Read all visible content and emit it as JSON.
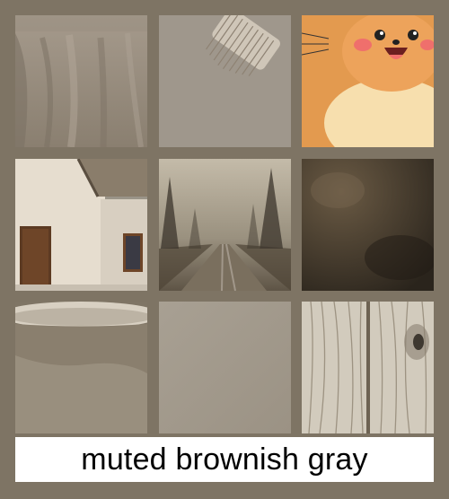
{
  "caption": {
    "text": "muted brownish gray"
  },
  "colors": {
    "background": "#7e7464",
    "caption_background": "#ffffff",
    "caption_text": "#000000"
  },
  "tiles": [
    {
      "subject": "draped-fabric"
    },
    {
      "subject": "paintbrush-on-gray-surface"
    },
    {
      "subject": "cartoon-cat"
    },
    {
      "subject": "cottage-with-thatched-roof"
    },
    {
      "subject": "foggy-forest-road"
    },
    {
      "subject": "dark-textured-wall"
    },
    {
      "subject": "ceramic-cup-closeup"
    },
    {
      "subject": "plain-gray-gradient"
    },
    {
      "subject": "weathered-wood-planks"
    }
  ]
}
